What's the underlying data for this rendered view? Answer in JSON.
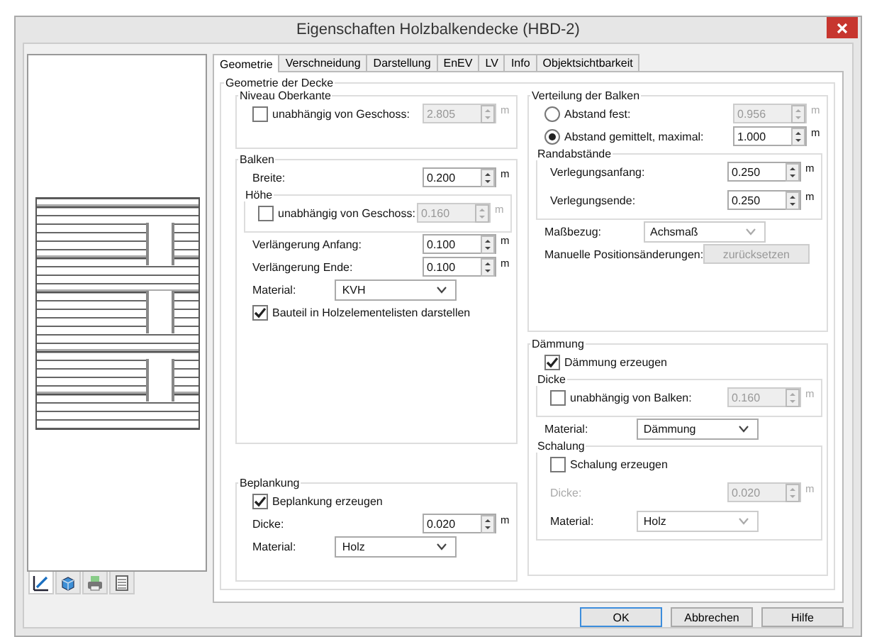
{
  "window": {
    "title": "Eigenschaften Holzbalkendecke (HBD-2)"
  },
  "preview_tabs": [
    {
      "kind": "pencil",
      "selected": true
    },
    {
      "kind": "cube",
      "selected": false
    },
    {
      "kind": "printer",
      "selected": false
    },
    {
      "kind": "list",
      "selected": false
    }
  ],
  "tabs": [
    {
      "label": "Geometrie",
      "selected": true
    },
    {
      "label": "Verschneidung",
      "selected": false
    },
    {
      "label": "Darstellung",
      "selected": false
    },
    {
      "label": "EnEV",
      "selected": false
    },
    {
      "label": "LV",
      "selected": false
    },
    {
      "label": "Info",
      "selected": false
    },
    {
      "label": "Objektsichtbarkeit",
      "selected": false
    }
  ],
  "panel": {
    "title": "Geometrie der Decke",
    "columns": [
      [
        {
          "title": "Niveau Oberkante",
          "rows": [
            {
              "kind": "check-spin",
              "label": "unabhängig von Geschoss:",
              "checked": false,
              "value": "2.805",
              "unit": "m",
              "disabled": true
            }
          ]
        },
        {
          "title": "Balken",
          "rows": [
            {
              "kind": "spin",
              "label": "Breite:",
              "value": "0.200",
              "unit": "m",
              "disabled": false
            },
            {
              "kind": "group",
              "title": "Höhe",
              "rows": [
                {
                  "kind": "check-spin",
                  "label": "unabhängig von Geschoss:",
                  "checked": false,
                  "value": "0.160",
                  "unit": "m",
                  "disabled": true
                }
              ]
            },
            {
              "kind": "spin",
              "label": "Verlängerung Anfang:",
              "value": "0.100",
              "unit": "m",
              "disabled": false
            },
            {
              "kind": "spin",
              "label": "Verlängerung Ende:",
              "value": "0.100",
              "unit": "m",
              "disabled": false
            },
            {
              "kind": "select",
              "label": "Material:",
              "value": "KVH",
              "disabled": false
            },
            {
              "kind": "check",
              "label": "Bauteil in Holzelementelisten darstellen",
              "checked": true
            }
          ]
        },
        {
          "title": "Beplankung",
          "rows": [
            {
              "kind": "check",
              "label": "Beplankung erzeugen",
              "checked": true
            },
            {
              "kind": "spin",
              "label": "Dicke:",
              "value": "0.020",
              "unit": "m",
              "disabled": false
            },
            {
              "kind": "select",
              "label": "Material:",
              "value": "Holz",
              "disabled": false
            }
          ]
        }
      ],
      [
        {
          "title": "Verteilung der Balken",
          "rows": [
            {
              "kind": "radio-spin",
              "label": "Abstand fest:",
              "selected": false,
              "value": "0.956",
              "unit": "m",
              "disabled": true
            },
            {
              "kind": "radio-spin",
              "label": "Abstand gemittelt, maximal:",
              "selected": true,
              "value": "1.000",
              "unit": "m",
              "disabled": false
            },
            {
              "kind": "group",
              "title": "Randabstände",
              "rows": [
                {
                  "kind": "spin",
                  "label": "Verlegungsanfang:",
                  "value": "0.250",
                  "unit": "m",
                  "disabled": false
                },
                {
                  "kind": "spin",
                  "label": "Verlegungsende:",
                  "value": "0.250",
                  "unit": "m",
                  "disabled": false
                }
              ]
            },
            {
              "kind": "select",
              "label": "Maßbezug:",
              "value": "Achsmaß",
              "disabled": true
            },
            {
              "kind": "action",
              "label": "Manuelle Positionsänderungen:",
              "button": "zurücksetzen",
              "disabled": true
            }
          ]
        },
        {
          "title": "Dämmung",
          "rows": [
            {
              "kind": "check",
              "label": "Dämmung erzeugen",
              "checked": true
            },
            {
              "kind": "group",
              "title": "Dicke",
              "rows": [
                {
                  "kind": "check-spin",
                  "label": "unabhängig von Balken:",
                  "checked": false,
                  "value": "0.160",
                  "unit": "m",
                  "disabled": true
                }
              ]
            },
            {
              "kind": "select",
              "label": "Material:",
              "value": "Dämmung",
              "disabled": false
            },
            {
              "kind": "group",
              "title": "Schalung",
              "rows": [
                {
                  "kind": "check",
                  "label": "Schalung erzeugen",
                  "checked": false
                },
                {
                  "kind": "spin",
                  "label": "Dicke:",
                  "value": "0.020",
                  "unit": "m",
                  "disabled": true
                },
                {
                  "kind": "select",
                  "label": "Material:",
                  "value": "Holz",
                  "disabled": true
                }
              ]
            }
          ]
        }
      ]
    ]
  },
  "buttons": [
    {
      "label": "OK",
      "default": true
    },
    {
      "label": "Abbrechen",
      "default": false
    },
    {
      "label": "Hilfe",
      "default": false
    }
  ]
}
